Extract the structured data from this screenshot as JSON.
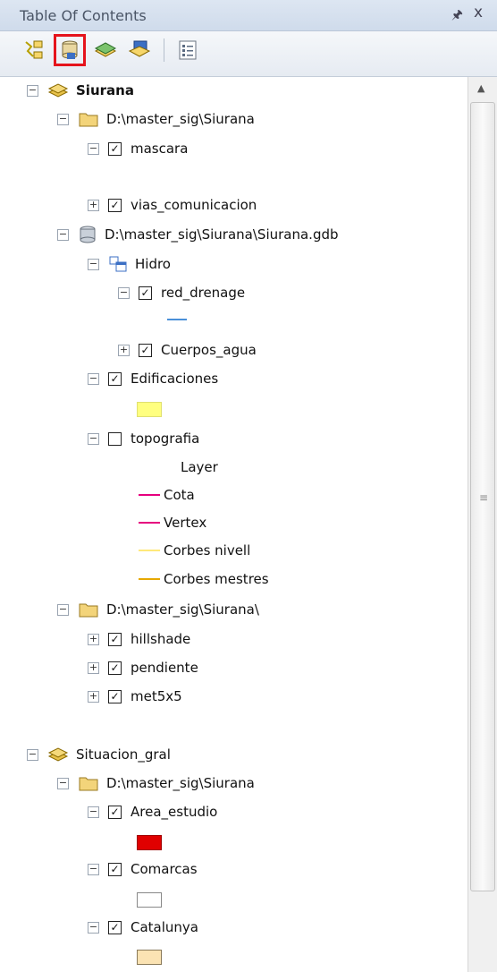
{
  "window": {
    "title": "Table Of Contents",
    "pin": "չ",
    "close": "x"
  },
  "toolbar": {
    "list_by_drawing_order": "list-by-drawing-order-icon",
    "list_by_source": "list-by-source-icon",
    "list_by_visibility": "list-by-visibility-icon",
    "list_by_selection": "list-by-selection-icon",
    "options": "options-icon"
  },
  "tree": {
    "siurana": "Siurana",
    "folder1": "D:\\master_sig\\Siurana",
    "mascara": "mascara",
    "vias": "vias_comunicacion",
    "gdb": "D:\\master_sig\\Siurana\\Siurana.gdb",
    "hidro": "Hidro",
    "red_drenage": "red_drenage",
    "cuerpos": "Cuerpos_agua",
    "edificaciones": "Edificaciones",
    "topografia": "topografia",
    "legend_header": "Layer",
    "cota": "Cota",
    "vertex": "Vertex",
    "corbes_nivell": "Corbes nivell",
    "corbes_mestres": "Corbes mestres",
    "folder2": "D:\\master_sig\\Siurana\\",
    "hillshade": "hillshade",
    "pendiente": "pendiente",
    "met5x5": "met5x5",
    "situacion": "Situacion_gral",
    "folder3": "D:\\master_sig\\Siurana",
    "area": "Area_estudio",
    "comarcas": "Comarcas",
    "catalunya": "Catalunya"
  },
  "colors": {
    "edificaciones": "#ffff80",
    "cota": "#e6007e",
    "vertex": "#e6007e",
    "corbes_nivell": "#ffe97a",
    "corbes_mestres": "#e6a800",
    "red_drenage": "#4a90d9",
    "area": "#e00000",
    "comarcas": "#ffffff",
    "catalunya": "#fbe3b3"
  }
}
